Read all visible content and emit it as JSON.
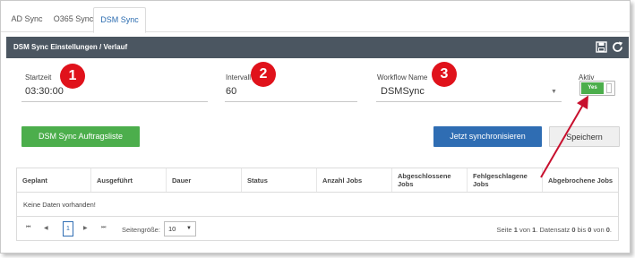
{
  "tabs": [
    {
      "label": "AD Sync"
    },
    {
      "label": "O365 Sync"
    },
    {
      "label": "DSM Sync"
    }
  ],
  "panel": {
    "title": "DSM Sync Einstellungen / Verlauf",
    "icons": [
      "save-icon",
      "refresh-icon"
    ]
  },
  "form": {
    "startzeit": {
      "label": "Startzeit",
      "value": "03:30:00"
    },
    "intervall": {
      "label": "Intervall",
      "value": "60"
    },
    "workflow": {
      "label": "Workflow Name",
      "value": "DSMSync"
    },
    "aktiv": {
      "label": "Aktiv",
      "toggle_text": "Yes",
      "checked": true
    }
  },
  "badges": [
    "1",
    "2",
    "3"
  ],
  "buttons": {
    "auftragsliste": "DSM Sync Auftragsliste",
    "sync_now": "Jetzt synchronisieren",
    "save": "Speichern"
  },
  "grid": {
    "columns": [
      "Geplant",
      "Ausgeführt",
      "Dauer",
      "Status",
      "Anzahl Jobs",
      "Abgeschlossene Jobs",
      "Fehlgeschlagene Jobs",
      "Abgebrochene Jobs"
    ],
    "empty_text": "Keine Daten vorhanden!",
    "pager": {
      "first": "⏮",
      "prev": "◀",
      "current_page": "1",
      "next": "▶",
      "last": "⏭",
      "page_size_label": "Seitengröße:",
      "page_size": "10",
      "info_prefix": "Seite ",
      "page": "1",
      "info_of": " von ",
      "total_pages": "1",
      "info_mid": ". Datensatz ",
      "rec_from": "0",
      "info_bis": " bis ",
      "rec_to": "0",
      "info_von": " von ",
      "rec_total": "0",
      "info_end": "."
    }
  },
  "colors": {
    "header_bg": "#4b5661",
    "green": "#4cae4c",
    "blue": "#2f6db3",
    "badge_red": "#e0121b"
  }
}
